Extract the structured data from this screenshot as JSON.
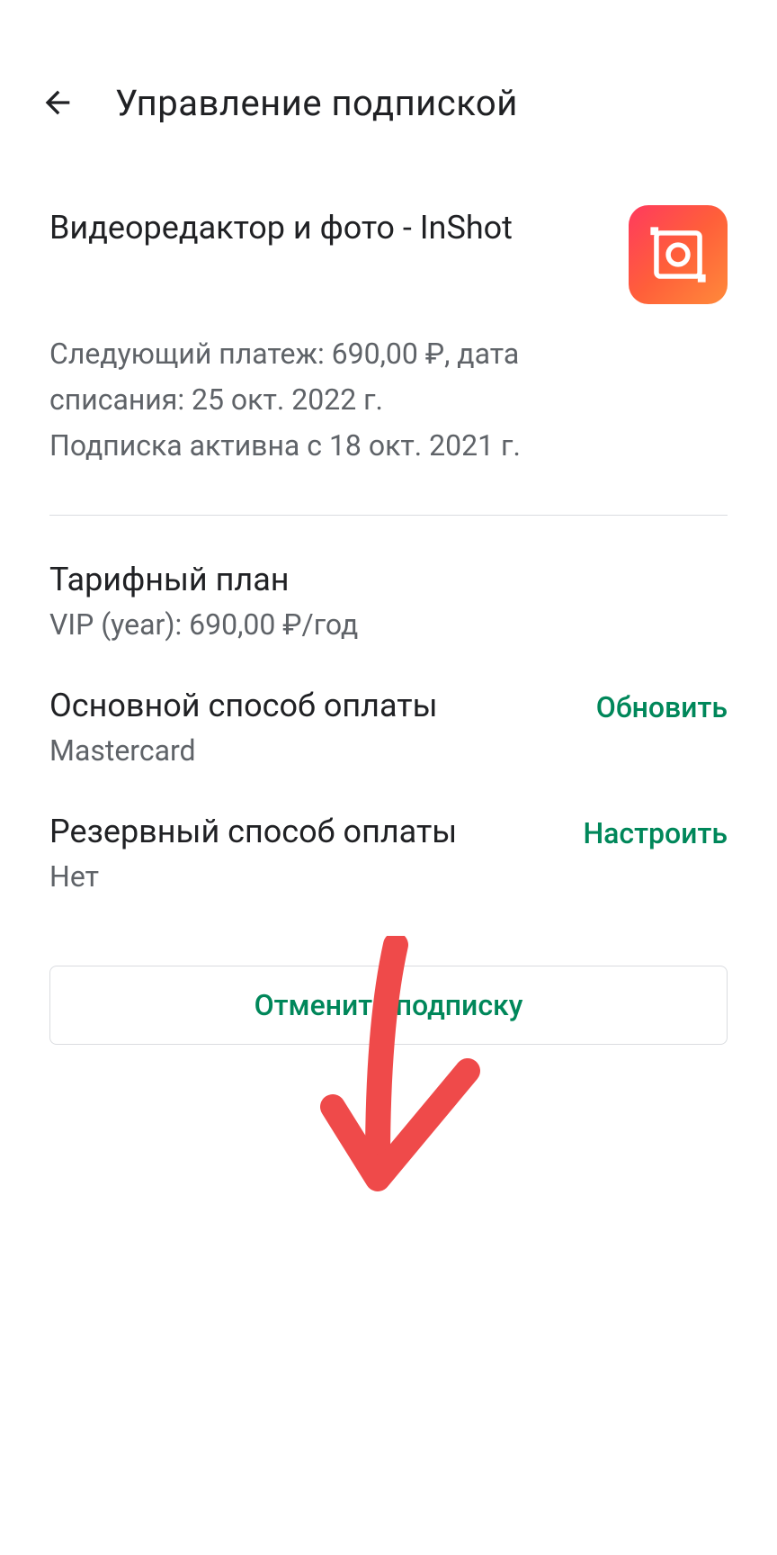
{
  "header": {
    "title": "Управление подпиской"
  },
  "app": {
    "name": "Видеоредактор и фото - InShot",
    "next_payment_line": "Следующий платеж: 690,00 ₽, дата списания: 25 окт. 2022 г.",
    "active_since_line": "Подписка активна с 18 окт. 2021 г."
  },
  "plan": {
    "title": "Тарифный план",
    "value": "VIP (year): 690,00 ₽/год"
  },
  "primary_payment": {
    "title": "Основной способ оплаты",
    "value": "Mastercard",
    "action": "Обновить"
  },
  "backup_payment": {
    "title": "Резервный способ оплаты",
    "value": "Нет",
    "action": "Настроить"
  },
  "cancel_button": "Отменить подписку"
}
